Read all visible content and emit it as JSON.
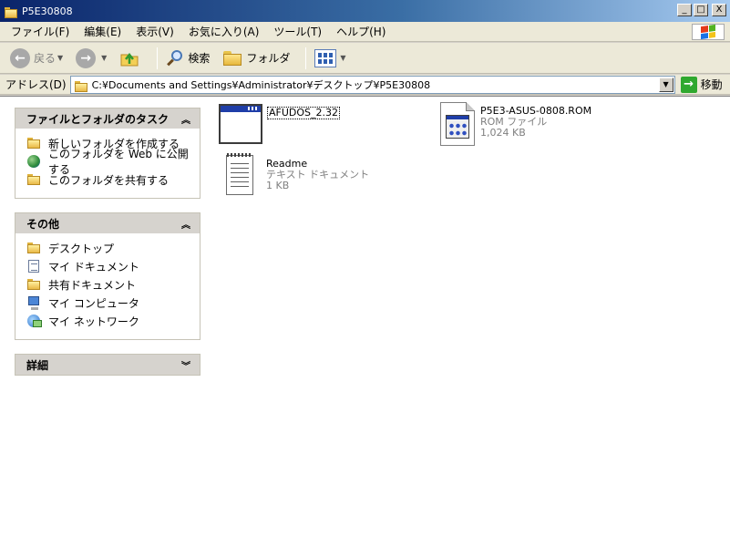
{
  "window": {
    "title": "P5E30808",
    "min_label": "_",
    "max_label": "□",
    "close_label": "X"
  },
  "menu": [
    "ファイル(F)",
    "編集(E)",
    "表示(V)",
    "お気に入り(A)",
    "ツール(T)",
    "ヘルプ(H)"
  ],
  "toolbar": {
    "back_label": "戻る",
    "search_label": "検索",
    "folders_label": "フォルダ"
  },
  "address": {
    "label": "アドレス(D)",
    "value": "C:¥Documents and Settings¥Administrator¥デスクトップ¥P5E30808",
    "go_label": "移動"
  },
  "tasks_panel": {
    "title": "ファイルとフォルダのタスク",
    "items": [
      "新しいフォルダを作成する",
      "このフォルダを Web に公開する",
      "このフォルダを共有する"
    ]
  },
  "other_panel": {
    "title": "その他",
    "items": [
      "デスクトップ",
      "マイ ドキュメント",
      "共有ドキュメント",
      "マイ コンピュータ",
      "マイ ネットワーク"
    ]
  },
  "details_panel": {
    "title": "詳細"
  },
  "files": [
    {
      "name": "AFUDOS_2.32",
      "type": "",
      "size": ""
    },
    {
      "name": "P5E3-ASUS-0808.ROM",
      "type": "ROM ファイル",
      "size": "1,024 KB"
    },
    {
      "name": "Readme",
      "type": "テキスト ドキュメント",
      "size": "1 KB"
    }
  ],
  "colors": {
    "titlebar_start": "#0a246a",
    "titlebar_end": "#a6caf0",
    "panel_header": "#d6d3ce",
    "go_green": "#2fa82f"
  }
}
